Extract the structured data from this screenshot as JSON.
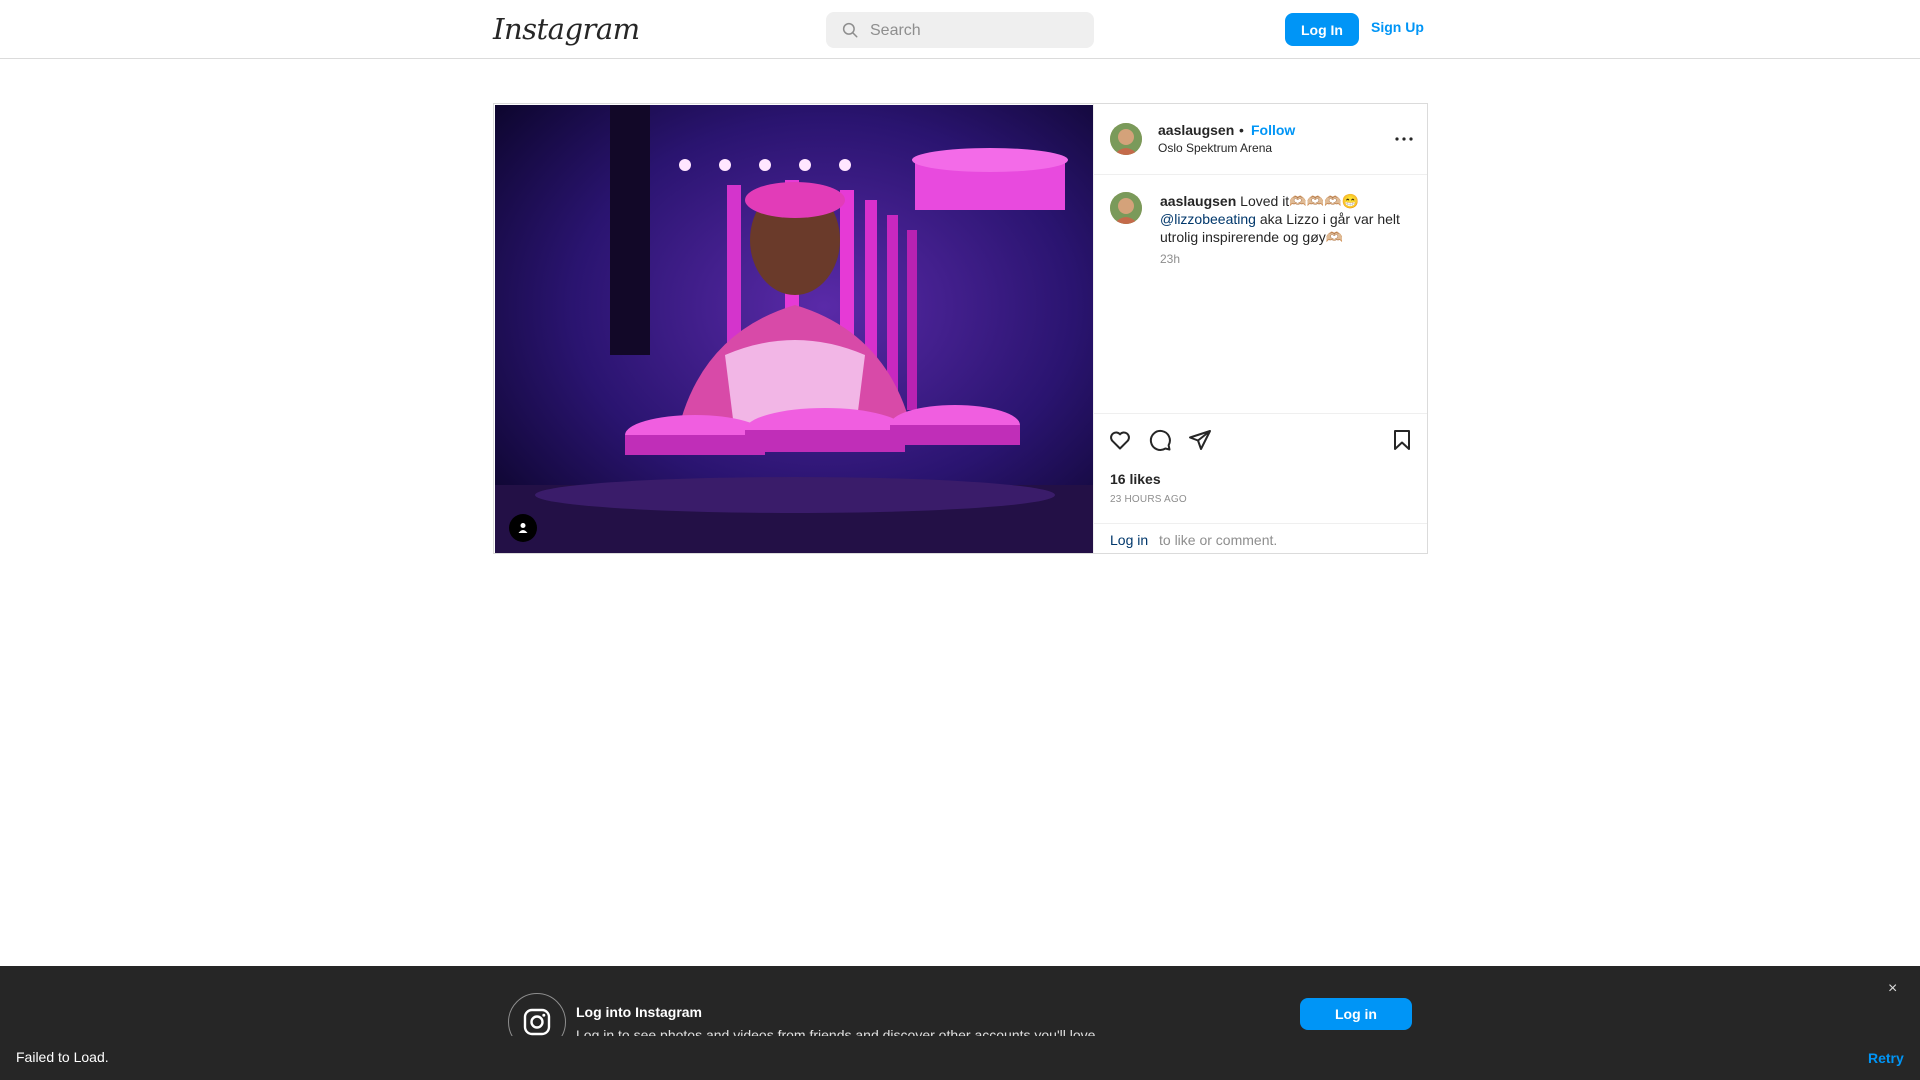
{
  "header": {
    "logo_text": "Instagram",
    "search_placeholder": "Search",
    "login_label": "Log In",
    "signup_label": "Sign Up",
    "accent_color": "#0095f6"
  },
  "post": {
    "username": "aaslaugsen",
    "separator": "•",
    "follow_label": "Follow",
    "location": "Oslo Spektrum Arena",
    "more_icon": "more-horizontal-icon",
    "caption": {
      "username": "aaslaugsen",
      "text_start": "Loved it🫶🏼🫶🏼🫶🏼😁",
      "mention": "@lizzobeeating",
      "text_end": "aka Lizzo i går var helt utrolig inspirerende og gøy🫶🏼",
      "time": "23h"
    },
    "actions": [
      "heart-icon",
      "comment-icon",
      "share-icon",
      "bookmark-icon"
    ],
    "likes": "16 likes",
    "posted_ago": "23 HOURS AGO",
    "login_link": "Log in",
    "login_rest": "to like or comment."
  },
  "banner": {
    "title": "Log into Instagram",
    "subtitle": "Log in to see photos and videos from friends and discover other accounts you'll love.",
    "button_label": "Log in",
    "close_glyph": "×"
  },
  "error_bar": {
    "message": "Failed to Load.",
    "retry_label": "Retry"
  }
}
